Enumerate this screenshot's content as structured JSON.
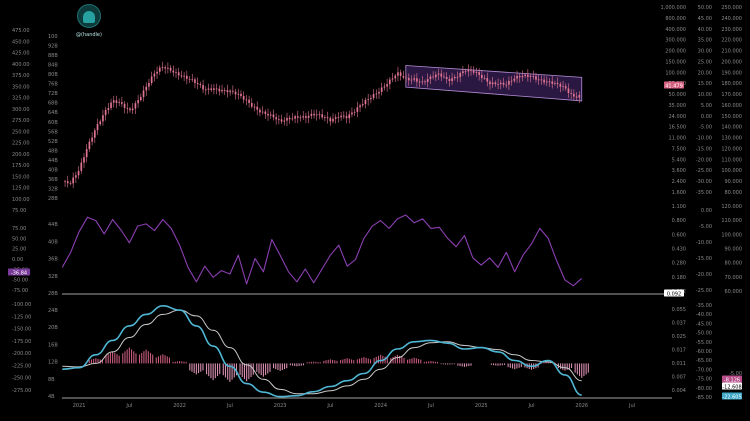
{
  "watermark": {
    "handle": "@(handle)",
    "icon": "hooded-figure-icon"
  },
  "colors": {
    "background": "#000000",
    "candle": "#e27593",
    "channel": "#b48ed8",
    "channel_fill": "#3a2058",
    "rsi": "#8c3fb2",
    "macd": "#4fb6d4",
    "signal": "#c9c9c9",
    "hist_pos": "#c65b7c",
    "hist_neg": "#d98fb0",
    "separator": "#d8d8d8"
  },
  "chart_data": [
    {
      "type": "candlestick",
      "panel": "price",
      "left_axis_labels": [
        "475.00",
        "450.00",
        "425.00",
        "400.00",
        "375.00",
        "350.00",
        "325.00",
        "300.00",
        "275.00",
        "250.00",
        "225.00",
        "200.00",
        "175.00",
        "150.00",
        "125.00",
        "100.00",
        "75.00"
      ],
      "inner_axis_labels": [
        "100",
        "92B",
        "88B",
        "84B",
        "80B",
        "76B",
        "72B",
        "68B",
        "64B",
        "60B",
        "56B",
        "52B",
        "48B",
        "44B",
        "40B",
        "36B",
        "32B",
        "28B"
      ],
      "right_axis_1_labels": [
        "1,000.000",
        "800.000",
        "400.000",
        "300.000",
        "200.000",
        "150.000",
        "100.000",
        "75.000",
        "50.000",
        "35.000",
        "24.000",
        "16.500",
        "11.000",
        "7.500",
        "5.400",
        "3.600",
        "2.400",
        "1.600"
      ],
      "right_axis_2_labels": [
        "50.00",
        "45.00",
        "40.00",
        "35.00",
        "30.00",
        "25.00",
        "20.00",
        "15.00",
        "10.00",
        "5.00",
        "0.00",
        "-5.00",
        "-10.00",
        "-15.00",
        "-20.00",
        "-25.00",
        "-30.00",
        "-35.00"
      ],
      "right_axis_3_labels": [
        "250.000",
        "240.000",
        "230.000",
        "220.000",
        "210.000",
        "200.000",
        "190.000",
        "180.000",
        "170.000",
        "160.000",
        "150.000",
        "140.000",
        "130.000",
        "120.000",
        "110.000",
        "100.000",
        "90.000",
        "80.000"
      ],
      "x_labels": [
        "2021",
        "Jul",
        "2022",
        "Jul",
        "2023",
        "Jul",
        "2024",
        "Jul",
        "2025",
        "Jul",
        "2026",
        "Jul"
      ],
      "ylim": [
        60,
        480
      ],
      "current_value_tag": "41.479",
      "left_value_tag": "",
      "channel": {
        "upper_start": {
          "x": "2024-04",
          "y": 415
        },
        "upper_end": {
          "x": "2026-01",
          "y": 385
        },
        "lower_start": {
          "x": "2024-04",
          "y": 360
        },
        "lower_end": {
          "x": "2026-01",
          "y": 325
        }
      },
      "close_path": [
        [
          "2020-11",
          120
        ],
        [
          "2020-12",
          112
        ],
        [
          "2021-01",
          145
        ],
        [
          "2021-02",
          210
        ],
        [
          "2021-03",
          262
        ],
        [
          "2021-04",
          295
        ],
        [
          "2021-05",
          320
        ],
        [
          "2021-06",
          315
        ],
        [
          "2021-07",
          302
        ],
        [
          "2021-08",
          330
        ],
        [
          "2021-09",
          360
        ],
        [
          "2021-10",
          390
        ],
        [
          "2021-11",
          410
        ],
        [
          "2021-12",
          407
        ],
        [
          "2022-01",
          395
        ],
        [
          "2022-02",
          380
        ],
        [
          "2022-03",
          365
        ],
        [
          "2022-04",
          352
        ],
        [
          "2022-05",
          362
        ],
        [
          "2022-06",
          355
        ],
        [
          "2022-07",
          346
        ],
        [
          "2022-08",
          336
        ],
        [
          "2022-09",
          326
        ],
        [
          "2022-10",
          312
        ],
        [
          "2022-11",
          296
        ],
        [
          "2022-12",
          282
        ],
        [
          "2023-01",
          268
        ],
        [
          "2023-02",
          282
        ],
        [
          "2023-03",
          290
        ],
        [
          "2023-04",
          284
        ],
        [
          "2023-05",
          286
        ],
        [
          "2023-06",
          283
        ],
        [
          "2023-07",
          279
        ],
        [
          "2023-08",
          292
        ],
        [
          "2023-09",
          283
        ],
        [
          "2023-10",
          296
        ],
        [
          "2023-11",
          320
        ],
        [
          "2023-12",
          342
        ],
        [
          "2024-01",
          358
        ],
        [
          "2024-02",
          372
        ],
        [
          "2024-03",
          390
        ],
        [
          "2024-04",
          380
        ],
        [
          "2024-05",
          385
        ],
        [
          "2024-06",
          375
        ],
        [
          "2024-07",
          382
        ],
        [
          "2024-08",
          388
        ],
        [
          "2024-09",
          378
        ],
        [
          "2024-10",
          392
        ],
        [
          "2024-11",
          405
        ],
        [
          "2024-12",
          396
        ],
        [
          "2025-01",
          383
        ],
        [
          "2025-02",
          372
        ],
        [
          "2025-03",
          375
        ],
        [
          "2025-04",
          368
        ],
        [
          "2025-05",
          378
        ],
        [
          "2025-06",
          386
        ],
        [
          "2025-07",
          392
        ],
        [
          "2025-08",
          383
        ],
        [
          "2025-09",
          372
        ],
        [
          "2025-10",
          362
        ],
        [
          "2025-11",
          356
        ],
        [
          "2025-12",
          340
        ],
        [
          "2026-01",
          344
        ]
      ]
    },
    {
      "type": "line",
      "panel": "oscillator",
      "left_axis_labels": [
        "75.00",
        "50.00",
        "25.00",
        "0.00",
        "-25.00",
        "-50.00",
        "-75.00"
      ],
      "inner_axis_labels": [
        "44B",
        "40B",
        "36B",
        "32B",
        "28B"
      ],
      "right_axis_1_labels": [
        "1.100",
        "0.800",
        "0.600",
        "0.430",
        "0.280",
        "0.180",
        "0.092"
      ],
      "right_axis_2_labels": [
        "0.00",
        "-5.00",
        "-10.00",
        "-15.00",
        "-20.00",
        "-25.00"
      ],
      "right_axis_3_labels": [
        "120.000",
        "110.000",
        "100.000",
        "90.000",
        "80.000",
        "70.000",
        "60.000"
      ],
      "left_value_tag": "-36.84",
      "right_value_tag": "0.092",
      "ylim": [
        -80,
        80
      ],
      "series": [
        {
          "values": [
            [
              "2020-11",
              -32
            ],
            [
              "2020-12",
              -5
            ],
            [
              "2021-01",
              32
            ],
            [
              "2021-02",
              58
            ],
            [
              "2021-03",
              52
            ],
            [
              "2021-04",
              28
            ],
            [
              "2021-05",
              54
            ],
            [
              "2021-06",
              35
            ],
            [
              "2021-07",
              12
            ],
            [
              "2021-08",
              42
            ],
            [
              "2021-09",
              46
            ],
            [
              "2021-10",
              34
            ],
            [
              "2021-11",
              54
            ],
            [
              "2021-12",
              38
            ],
            [
              "2022-01",
              8
            ],
            [
              "2022-02",
              -32
            ],
            [
              "2022-03",
              -58
            ],
            [
              "2022-04",
              -30
            ],
            [
              "2022-05",
              -50
            ],
            [
              "2022-06",
              -38
            ],
            [
              "2022-07",
              -44
            ],
            [
              "2022-08",
              -10
            ],
            [
              "2022-09",
              -62
            ],
            [
              "2022-10",
              -16
            ],
            [
              "2022-11",
              -40
            ],
            [
              "2022-12",
              18
            ],
            [
              "2023-01",
              -10
            ],
            [
              "2023-02",
              -40
            ],
            [
              "2023-03",
              -58
            ],
            [
              "2023-04",
              -35
            ],
            [
              "2023-05",
              -60
            ],
            [
              "2023-06",
              -35
            ],
            [
              "2023-07",
              -10
            ],
            [
              "2023-08",
              8
            ],
            [
              "2023-09",
              -30
            ],
            [
              "2023-10",
              -18
            ],
            [
              "2023-11",
              20
            ],
            [
              "2023-12",
              42
            ],
            [
              "2024-01",
              52
            ],
            [
              "2024-02",
              38
            ],
            [
              "2024-03",
              55
            ],
            [
              "2024-04",
              62
            ],
            [
              "2024-05",
              48
            ],
            [
              "2024-06",
              55
            ],
            [
              "2024-07",
              38
            ],
            [
              "2024-08",
              40
            ],
            [
              "2024-09",
              20
            ],
            [
              "2024-10",
              5
            ],
            [
              "2024-11",
              25
            ],
            [
              "2024-12",
              -15
            ],
            [
              "2025-01",
              -28
            ],
            [
              "2025-02",
              -15
            ],
            [
              "2025-03",
              -32
            ],
            [
              "2025-04",
              -5
            ],
            [
              "2025-05",
              -40
            ],
            [
              "2025-06",
              -10
            ],
            [
              "2025-07",
              10
            ],
            [
              "2025-08",
              38
            ],
            [
              "2025-09",
              20
            ],
            [
              "2025-10",
              -20
            ],
            [
              "2025-11",
              -55
            ],
            [
              "2025-12",
              -65
            ],
            [
              "2026-01",
              -52
            ]
          ]
        }
      ]
    },
    {
      "type": "macd",
      "panel": "macd",
      "left_axis_labels": [
        "-100.00",
        "-125.00",
        "-150.00",
        "-175.00",
        "-200.00",
        "-225.00",
        "-250.00",
        "-275.00"
      ],
      "inner_axis_labels": [
        "24B",
        "20B",
        "16B",
        "12B",
        "8B",
        "4B"
      ],
      "right_axis_1_labels": [
        "0.055",
        "0.037",
        "0.025",
        "0.017",
        "0.011",
        "0.007",
        "0.004"
      ],
      "right_axis_2_labels": [
        "-35.00",
        "-40.00",
        "-45.00",
        "-50.00",
        "-55.00",
        "-60.00",
        "-65.00",
        "-70.00",
        "-75.00",
        "-80.00",
        "-85.00"
      ],
      "right_axis_3_labels": [
        "-5.00",
        "-7.50",
        "-10.00"
      ],
      "right_value_tags": [
        "-8.126",
        "-12.608",
        "-22.605"
      ],
      "ylim": [
        -120,
        220
      ],
      "series": [
        {
          "name": "",
          "values": [
            [
              "2020-11",
              -20
            ],
            [
              "2021-01",
              -15
            ],
            [
              "2021-03",
              30
            ],
            [
              "2021-05",
              80
            ],
            [
              "2021-07",
              130
            ],
            [
              "2021-09",
              170
            ],
            [
              "2021-11",
              200
            ],
            [
              "2022-01",
              185
            ],
            [
              "2022-03",
              130
            ],
            [
              "2022-05",
              60
            ],
            [
              "2022-07",
              -10
            ],
            [
              "2022-09",
              -70
            ],
            [
              "2022-11",
              -100
            ],
            [
              "2023-01",
              -115
            ],
            [
              "2023-03",
              -112
            ],
            [
              "2023-05",
              -98
            ],
            [
              "2023-07",
              -80
            ],
            [
              "2023-09",
              -60
            ],
            [
              "2023-11",
              -35
            ],
            [
              "2024-01",
              10
            ],
            [
              "2024-03",
              50
            ],
            [
              "2024-05",
              75
            ],
            [
              "2024-07",
              80
            ],
            [
              "2024-09",
              70
            ],
            [
              "2024-11",
              50
            ],
            [
              "2025-01",
              55
            ],
            [
              "2025-03",
              40
            ],
            [
              "2025-05",
              10
            ],
            [
              "2025-07",
              -10
            ],
            [
              "2025-09",
              10
            ],
            [
              "2025-11",
              -40
            ],
            [
              "2026-01",
              -110
            ]
          ]
        },
        {
          "name": "",
          "values": [
            [
              "2020-11",
              -10
            ],
            [
              "2021-01",
              -12
            ],
            [
              "2021-03",
              0
            ],
            [
              "2021-05",
              40
            ],
            [
              "2021-07",
              90
            ],
            [
              "2021-09",
              135
            ],
            [
              "2021-11",
              170
            ],
            [
              "2022-01",
              185
            ],
            [
              "2022-03",
              165
            ],
            [
              "2022-05",
              115
            ],
            [
              "2022-07",
              55
            ],
            [
              "2022-09",
              -5
            ],
            [
              "2022-11",
              -55
            ],
            [
              "2023-01",
              -90
            ],
            [
              "2023-03",
              -105
            ],
            [
              "2023-05",
              -105
            ],
            [
              "2023-07",
              -95
            ],
            [
              "2023-09",
              -78
            ],
            [
              "2023-11",
              -55
            ],
            [
              "2024-01",
              -20
            ],
            [
              "2024-03",
              20
            ],
            [
              "2024-05",
              55
            ],
            [
              "2024-07",
              72
            ],
            [
              "2024-09",
              75
            ],
            [
              "2024-11",
              62
            ],
            [
              "2025-01",
              55
            ],
            [
              "2025-03",
              48
            ],
            [
              "2025-05",
              30
            ],
            [
              "2025-07",
              10
            ],
            [
              "2025-09",
              5
            ],
            [
              "2025-11",
              -15
            ],
            [
              "2026-01",
              -60
            ]
          ]
        }
      ],
      "histogram": [
        [
          "2021-03",
          18
        ],
        [
          "2021-05",
          42
        ],
        [
          "2021-07",
          55
        ],
        [
          "2021-09",
          48
        ],
        [
          "2021-11",
          32
        ],
        [
          "2022-01",
          8
        ],
        [
          "2022-03",
          -38
        ],
        [
          "2022-05",
          -58
        ],
        [
          "2022-07",
          -64
        ],
        [
          "2022-09",
          -62
        ],
        [
          "2022-11",
          -46
        ],
        [
          "2023-01",
          -26
        ],
        [
          "2023-03",
          -10
        ],
        [
          "2023-05",
          6
        ],
        [
          "2023-07",
          14
        ],
        [
          "2023-09",
          18
        ],
        [
          "2023-11",
          22
        ],
        [
          "2024-01",
          30
        ],
        [
          "2024-03",
          30
        ],
        [
          "2024-05",
          20
        ],
        [
          "2024-07",
          8
        ],
        [
          "2024-09",
          -4
        ],
        [
          "2024-11",
          -12
        ],
        [
          "2025-01",
          0
        ],
        [
          "2025-03",
          -8
        ],
        [
          "2025-05",
          -20
        ],
        [
          "2025-07",
          -22
        ],
        [
          "2025-09",
          5
        ],
        [
          "2025-11",
          -25
        ],
        [
          "2026-01",
          -50
        ]
      ]
    }
  ]
}
